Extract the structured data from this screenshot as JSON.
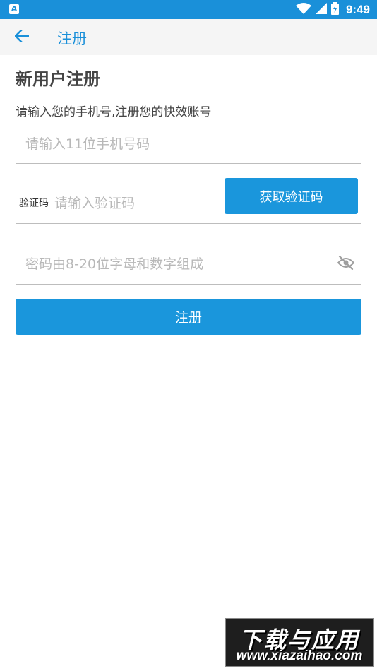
{
  "status_bar": {
    "app_icon_letter": "A",
    "time": "9:49",
    "icons": [
      "wifi-icon",
      "signal-icon",
      "battery-icon"
    ],
    "background": "#1a90d9"
  },
  "app_bar": {
    "back_icon": "arrow-left-icon",
    "title": "注册"
  },
  "page": {
    "heading": "新用户注册",
    "subtitle": "请输入您的手机号,注册您的快效账号"
  },
  "form": {
    "phone_placeholder": "请输入11位手机号码",
    "code_label": "验证码",
    "code_placeholder": "请输入验证码",
    "get_code_label": "获取验证码",
    "password_placeholder": "密码由8-20位字母和数字组成",
    "password_toggle_icon": "eye-off-icon",
    "submit_label": "注册"
  },
  "watermark": {
    "title": "下载与应用",
    "url": "www.xiazaihao.com"
  },
  "colors": {
    "accent": "#1a96dc",
    "text": "#444444",
    "placeholder": "#b8b8b8",
    "divider": "#bdbdbd"
  }
}
